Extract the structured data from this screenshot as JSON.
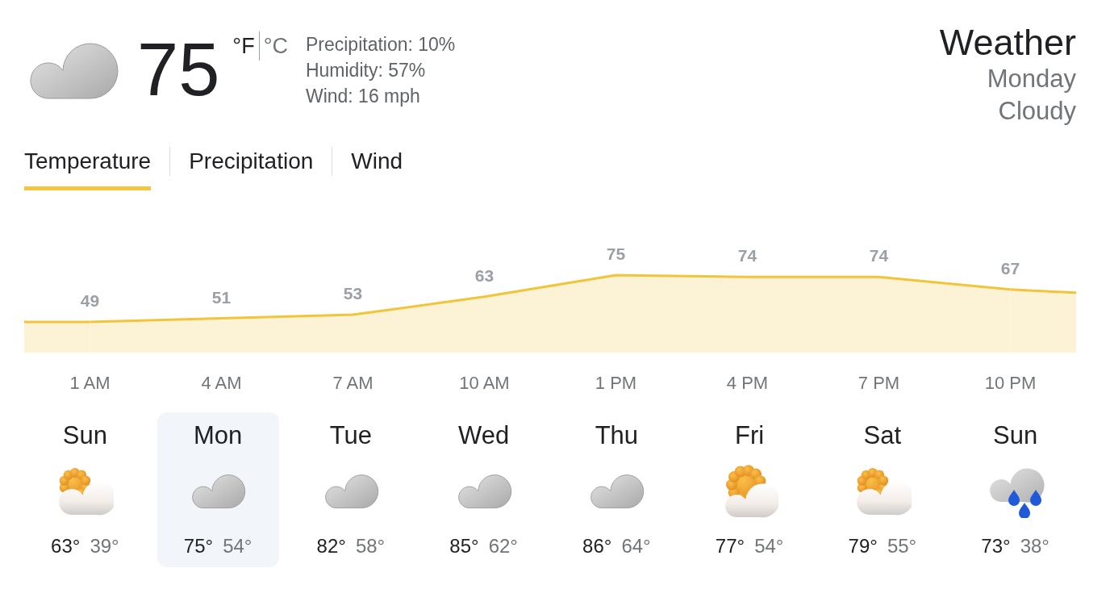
{
  "current": {
    "temperature": "75",
    "units": [
      {
        "label": "°F",
        "selected": true
      },
      {
        "label": "°C",
        "selected": false
      }
    ],
    "details": [
      "Precipitation: 10%",
      "Humidity: 57%",
      "Wind: 16 mph"
    ]
  },
  "summary": {
    "title": "Weather",
    "day": "Monday",
    "condition": "Cloudy"
  },
  "tabs": [
    {
      "label": "Temperature",
      "selected": true
    },
    {
      "label": "Precipitation",
      "selected": false
    },
    {
      "label": "Wind",
      "selected": false
    }
  ],
  "hourly": {
    "chart_data": {
      "type": "area",
      "categories": [
        "1 AM",
        "4 AM",
        "7 AM",
        "10 AM",
        "1 PM",
        "4 PM",
        "7 PM",
        "10 PM"
      ],
      "values": [
        49,
        51,
        53,
        63,
        75,
        74,
        74,
        67
      ],
      "data_labels": true
    }
  },
  "days": [
    {
      "name": "Sun",
      "kind": "partly-cloudy",
      "high": "63°",
      "low": "39°",
      "selected": false
    },
    {
      "name": "Mon",
      "kind": "cloudy",
      "high": "75°",
      "low": "54°",
      "selected": true
    },
    {
      "name": "Tue",
      "kind": "cloudy",
      "high": "82°",
      "low": "58°",
      "selected": false
    },
    {
      "name": "Wed",
      "kind": "cloudy",
      "high": "85°",
      "low": "62°",
      "selected": false
    },
    {
      "name": "Thu",
      "kind": "cloudy",
      "high": "86°",
      "low": "64°",
      "selected": false
    },
    {
      "name": "Fri",
      "kind": "mostly-sunny",
      "high": "77°",
      "low": "54°",
      "selected": false
    },
    {
      "name": "Sat",
      "kind": "partly-cloudy",
      "high": "79°",
      "low": "55°",
      "selected": false
    },
    {
      "name": "Sun",
      "kind": "rain",
      "high": "73°",
      "low": "38°",
      "selected": false
    }
  ]
}
